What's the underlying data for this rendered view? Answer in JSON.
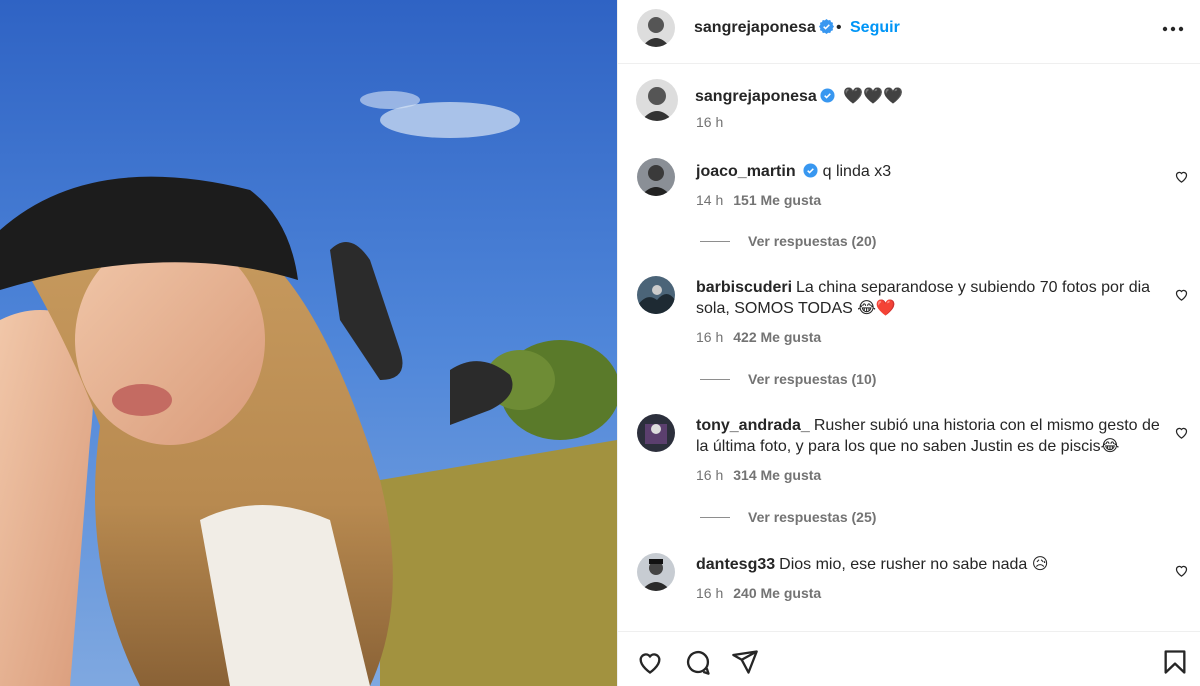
{
  "post": {
    "username": "sangrejaponesa",
    "follow_label": "Seguir",
    "separator": "•",
    "caption": "🖤🖤🖤",
    "time": "16 h",
    "image_icon": "photo-of-person-lying-on-grass"
  },
  "comments": [
    {
      "username": "joaco_martin",
      "verified": true,
      "text": "q linda x3",
      "time": "14 h",
      "likes": "151 Me gusta",
      "replies": "Ver respuestas (20)"
    },
    {
      "username": "barbiscuderi",
      "verified": false,
      "text": "La china separandose y subiendo 70 fotos por dia sola, SOMOS TODAS 😂❤️",
      "time": "16 h",
      "likes": "422 Me gusta",
      "replies": "Ver respuestas (10)"
    },
    {
      "username": "tony_andrada_",
      "verified": false,
      "text": "Rusher subió una historia con el mismo gesto de la última foto, y para los que no saben Justin es de piscis😂",
      "time": "16 h",
      "likes": "314 Me gusta",
      "replies": "Ver respuestas (25)"
    },
    {
      "username": "dantesg33",
      "verified": false,
      "text": "Dios mio, ese rusher no sabe nada 😥",
      "time": "16 h",
      "likes": "240 Me gusta"
    }
  ],
  "icons": {
    "more": "more-horizontal-icon",
    "like": "heart-icon",
    "comment": "comment-bubble-icon",
    "share": "paper-plane-icon",
    "save": "bookmark-icon",
    "verified": "verified-badge-icon"
  },
  "colors": {
    "link": "#0095f6",
    "verified": "#3897f0",
    "text": "#262626",
    "muted": "#737373",
    "border": "#efefef"
  }
}
